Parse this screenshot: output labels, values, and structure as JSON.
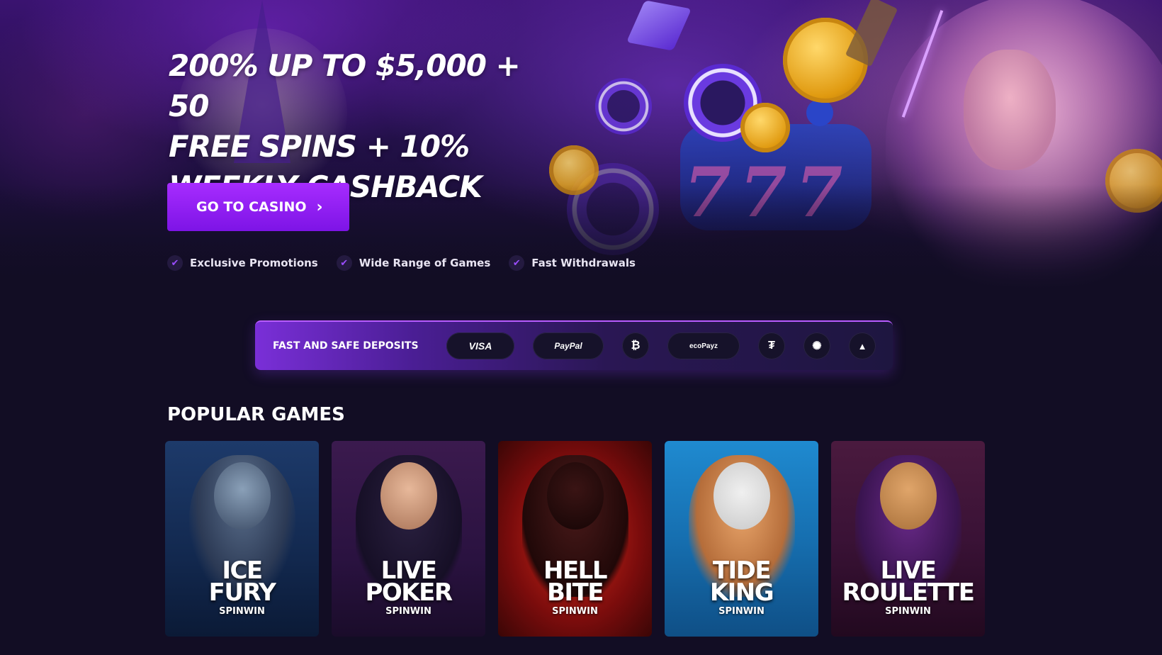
{
  "hero": {
    "headline_lines": [
      "200% UP TO $5,000 + 50",
      "FREE SPINS + 10%",
      "WEEKLY CASHBACK"
    ],
    "cta_label": "GO TO CASINO",
    "features": [
      "Exclusive Promotions",
      "Wide Range of Games",
      "Fast Withdrawals"
    ]
  },
  "deposits": {
    "label": "FAST AND SAFE DEPOSITS",
    "methods": [
      {
        "name": "visa",
        "text": "VISA",
        "icon": "visa-icon"
      },
      {
        "name": "paypal",
        "text": "PayPal",
        "icon": "paypal-icon"
      },
      {
        "name": "bitcoin",
        "text": "₿",
        "icon": "bitcoin-icon"
      },
      {
        "name": "ecopayz",
        "text": "ecoPayz",
        "icon": "ecopayz-icon"
      },
      {
        "name": "tether",
        "text": "₮",
        "icon": "tether-icon"
      },
      {
        "name": "cardano",
        "text": "✺",
        "icon": "cardano-icon"
      },
      {
        "name": "avalanche",
        "text": "▲",
        "icon": "avalanche-icon"
      }
    ]
  },
  "games": {
    "section_title": "POPULAR GAMES",
    "items": [
      {
        "title": "ICE\nFURY",
        "brand": "SPINWIN"
      },
      {
        "title": "LIVE\nPOKER",
        "brand": "SPINWIN"
      },
      {
        "title": "HELL\nBITE",
        "brand": "SPINWIN"
      },
      {
        "title": "TIDE\nKING",
        "brand": "SPINWIN"
      },
      {
        "title": "LIVE\nROULETTE",
        "brand": "SPINWIN"
      }
    ]
  },
  "colors": {
    "background": "#120d24",
    "accent_purple": "#8b1ff0",
    "check_purple": "#9b4dff"
  }
}
